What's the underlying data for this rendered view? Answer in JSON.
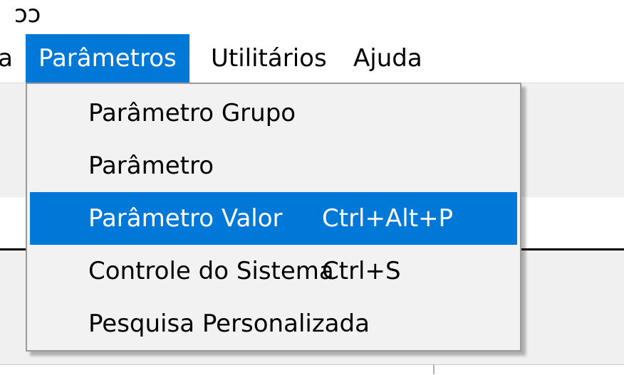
{
  "title_fragment": "ɔɔ",
  "menubar": {
    "cut_item_label": "a",
    "items": [
      {
        "label": "Parâmetros"
      },
      {
        "label": "Utilitários"
      },
      {
        "label": "Ajuda"
      }
    ]
  },
  "dropdown": {
    "items": [
      {
        "label": "Parâmetro Grupo",
        "shortcut": ""
      },
      {
        "label": "Parâmetro",
        "shortcut": ""
      },
      {
        "label": "Parâmetro Valor",
        "shortcut": "Ctrl+Alt+P"
      },
      {
        "label": "Controle do Sistema",
        "shortcut": "Ctrl+S"
      },
      {
        "label": "Pesquisa Personalizada",
        "shortcut": ""
      }
    ],
    "highlighted_index": 2
  },
  "colors": {
    "accent": "#0078d7",
    "menu_background": "#f2f2f2",
    "window_background": "#f0f0f0"
  }
}
